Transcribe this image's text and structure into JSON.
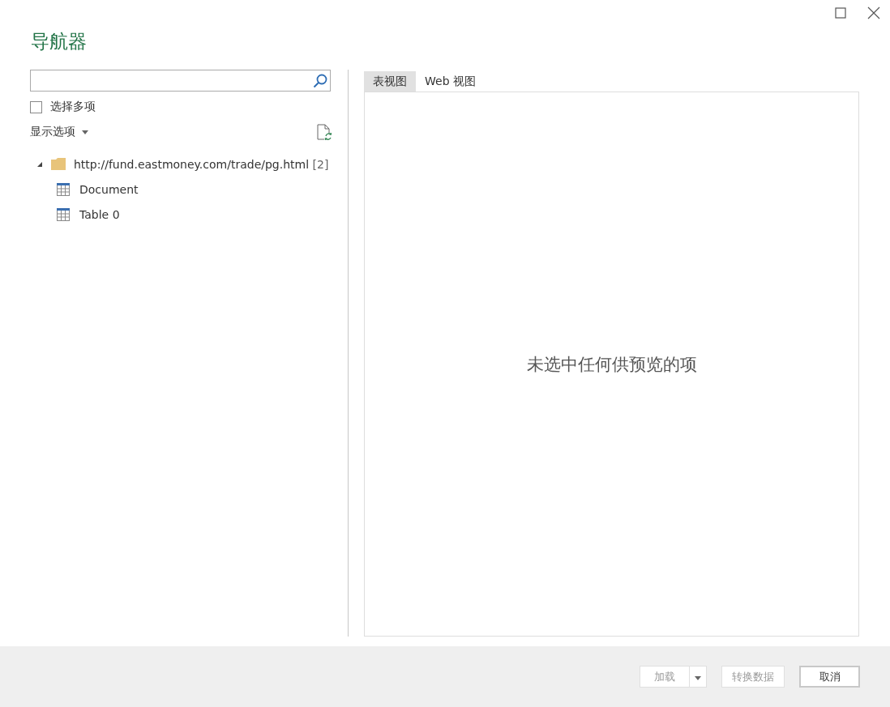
{
  "window": {
    "title": "导航器"
  },
  "multi_select": {
    "label": "选择多项",
    "checked": false
  },
  "display_options": {
    "label": "显示选项"
  },
  "tree": [
    {
      "label": "http://fund.eastmoney.com/trade/pg.html",
      "count": "[2]",
      "kind": "folder",
      "expanded": true,
      "children": [
        {
          "label": "Document",
          "kind": "table"
        },
        {
          "label": "Table 0",
          "kind": "table"
        }
      ]
    }
  ],
  "tabs": [
    {
      "label": "表视图",
      "selected": true
    },
    {
      "label": "Web 视图",
      "selected": false
    }
  ],
  "preview": {
    "message": "未选中任何供预览的项"
  },
  "buttons": [
    {
      "label": "加载",
      "kind": "split",
      "disabled": true
    },
    {
      "label": "转换数据",
      "kind": "plain",
      "disabled": true
    },
    {
      "label": "取消",
      "kind": "plain",
      "disabled": false
    }
  ]
}
